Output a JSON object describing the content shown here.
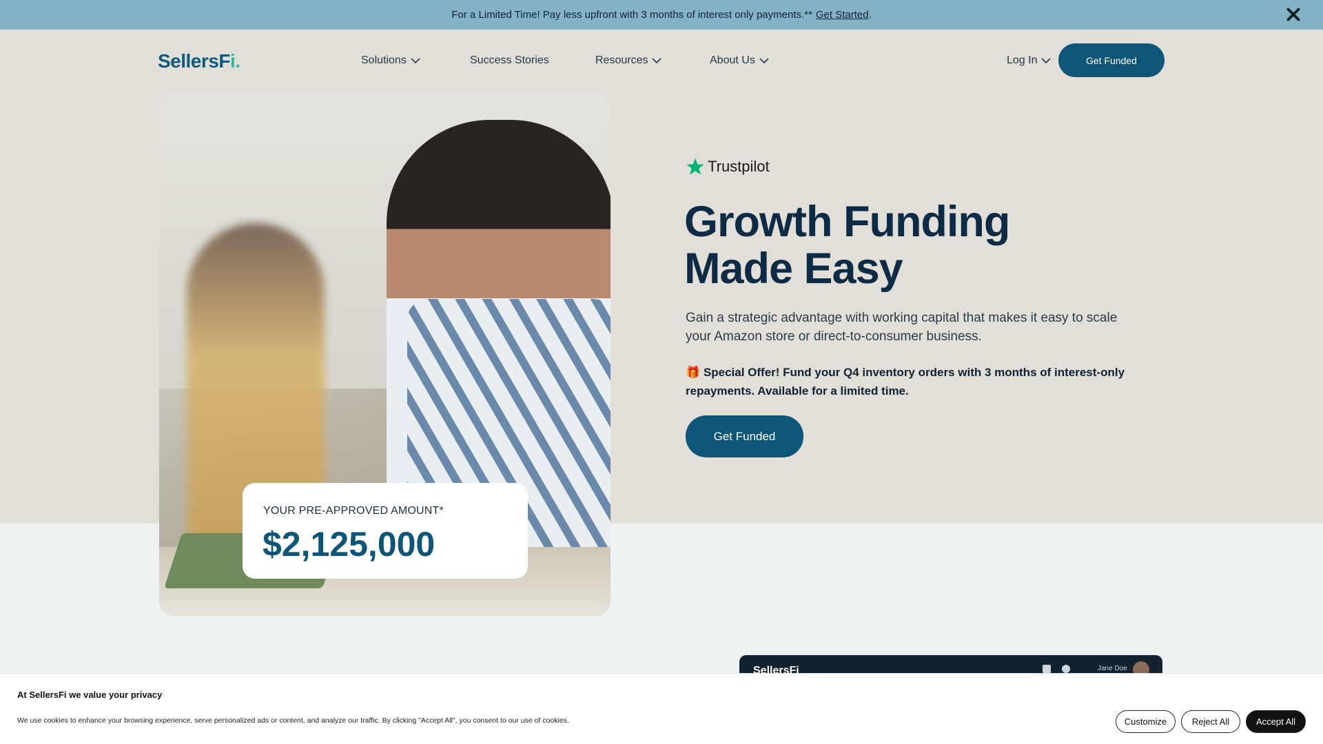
{
  "promo": {
    "text": "For a Limited Time! Pay less upfront with 3 months of interest only payments.**",
    "link": "Get Started",
    "suffix": "."
  },
  "nav": {
    "logo_main": "SellersF",
    "logo_end": "i.",
    "items": [
      {
        "label": "Solutions"
      },
      {
        "label": "Success Stories"
      },
      {
        "label": "Resources"
      },
      {
        "label": "About Us"
      }
    ],
    "login": "Log In",
    "cta": "Get Funded"
  },
  "hero": {
    "trustpilot": "Trustpilot",
    "title_line1": "Growth Funding",
    "title_line2": "Made Easy",
    "subtitle": "Gain a strategic advantage with working capital that makes it easy to scale your Amazon store or direct-to-consumer business.",
    "offer": "🎁 Special Offer! Fund your Q4 inventory orders with 3 months of interest-only repayments. Available for a limited time.",
    "cta": "Get Funded",
    "card_label": "YOUR PRE-APPROVED AMOUNT*",
    "card_amount": "$2,125,000"
  },
  "app_preview": {
    "logo": "SellersFi",
    "user": "Jane Doe"
  },
  "cookie": {
    "title": "At SellersFi we value your privacy",
    "text": "We use cookies to enhance your browsing experience, serve personalized ads or content, and analyze our traffic. By clicking \"Accept All\", you consent to our use of cookies.",
    "customize": "Customize",
    "reject": "Reject All",
    "accept": "Accept All"
  },
  "colors": {
    "promo_bg": "#84b3c7",
    "brand": "#0d5677",
    "trustpilot_green": "#00b67a"
  }
}
